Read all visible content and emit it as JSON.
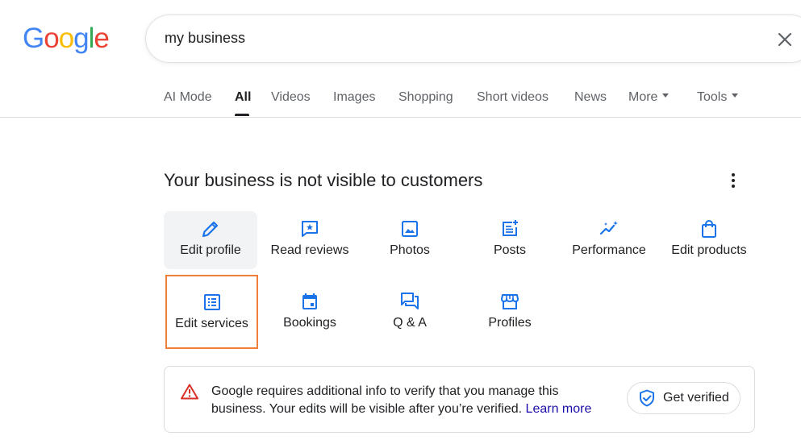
{
  "logo": {
    "letters": [
      "G",
      "o",
      "o",
      "g",
      "l",
      "e"
    ],
    "colors": [
      "#4285f4",
      "#ea4335",
      "#fbbc05",
      "#4285f4",
      "#34a853",
      "#ea4335"
    ]
  },
  "search": {
    "query": "my business"
  },
  "tabs": [
    {
      "label": "AI Mode"
    },
    {
      "label": "All",
      "active": true
    },
    {
      "label": "Videos"
    },
    {
      "label": "Images"
    },
    {
      "label": "Shopping"
    },
    {
      "label": "Short videos"
    },
    {
      "label": "News"
    },
    {
      "label": "More"
    },
    {
      "label": "Tools"
    }
  ],
  "panel": {
    "title": "Your business is not visible to customers",
    "actions": [
      {
        "label": "Edit profile",
        "icon": "pencil-icon"
      },
      {
        "label": "Read reviews",
        "icon": "review-star-icon"
      },
      {
        "label": "Photos",
        "icon": "photo-icon"
      },
      {
        "label": "Posts",
        "icon": "post-add-icon"
      },
      {
        "label": "Performance",
        "icon": "sparkle-trend-icon"
      },
      {
        "label": "Edit products",
        "icon": "shopping-bag-icon"
      },
      {
        "label": "Edit services",
        "icon": "list-alt-icon"
      },
      {
        "label": "Bookings",
        "icon": "calendar-icon"
      },
      {
        "label": "Q & A",
        "icon": "forum-icon"
      },
      {
        "label": "Profiles",
        "icon": "storefront-icon"
      }
    ]
  },
  "notice": {
    "text": "Google requires additional info to verify that you manage this business. Your edits will be visible after you’re verified.",
    "link": "Learn more",
    "button": "Get verified"
  },
  "colors": {
    "accent": "#1a73e8",
    "link": "#1a0dab",
    "warning": "#d93025",
    "highlight_border": "#f07f3c"
  }
}
